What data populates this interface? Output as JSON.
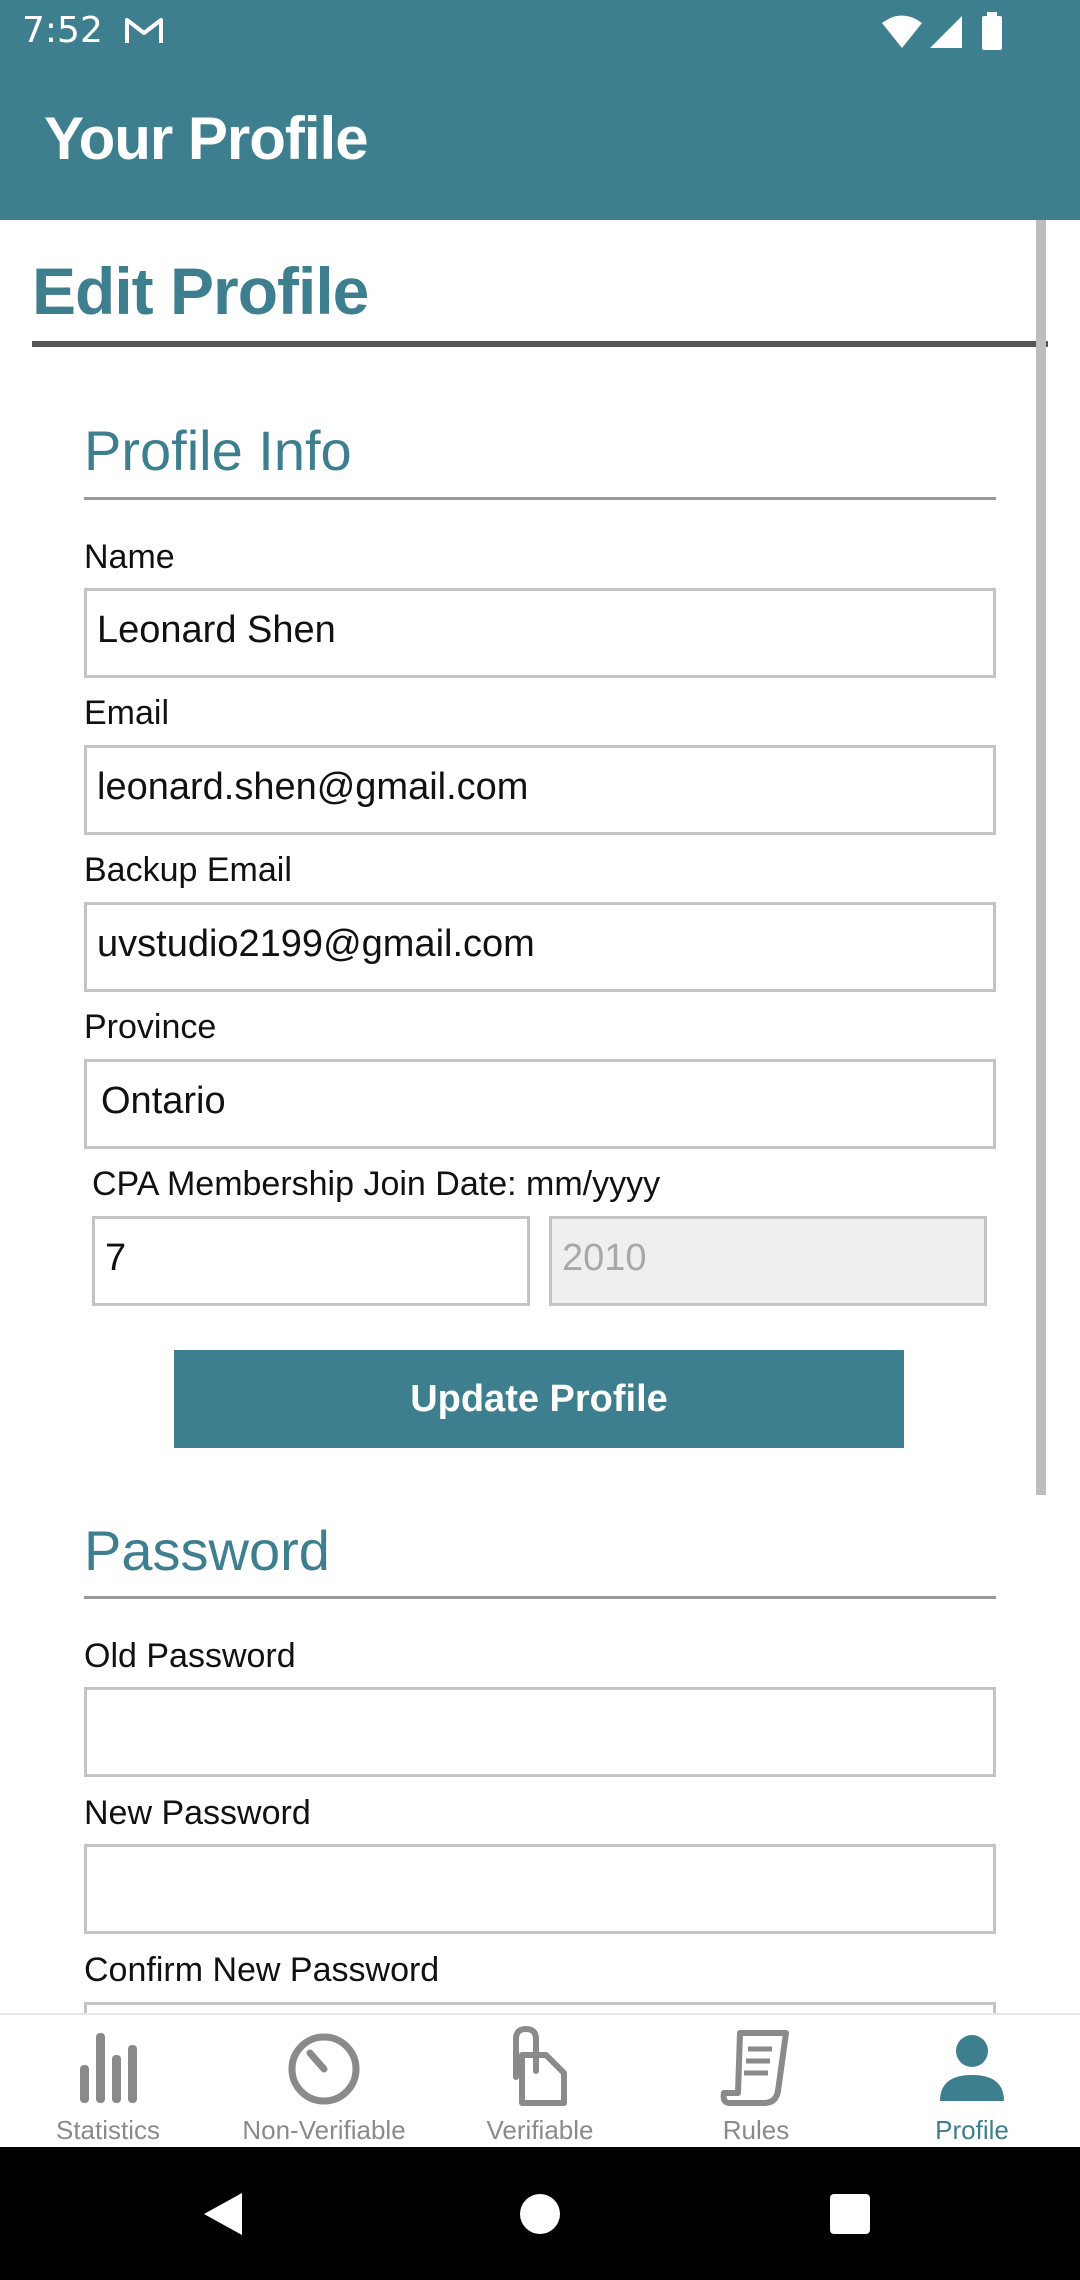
{
  "status_bar": {
    "time": "7:52"
  },
  "app_bar": {
    "title": "Your Profile"
  },
  "page": {
    "title": "Edit Profile"
  },
  "profile_info": {
    "heading": "Profile Info",
    "name_label": "Name",
    "name_value": "Leonard Shen",
    "email_label": "Email",
    "email_value": "leonard.shen@gmail.com",
    "backup_email_label": "Backup Email",
    "backup_email_value": "uvstudio2199@gmail.com",
    "province_label": "Province",
    "province_value": "Ontario",
    "join_date_label": "CPA Membership Join Date: mm/yyyy",
    "join_month_value": "7",
    "join_year_placeholder": "2010",
    "update_button": "Update Profile"
  },
  "password": {
    "heading": "Password",
    "old_label": "Old Password",
    "new_label": "New Password",
    "confirm_label": "Confirm New Password"
  },
  "bottom_nav": {
    "items": [
      {
        "label": "Statistics",
        "icon": "bar-chart-icon",
        "active": false
      },
      {
        "label": "Non-Verifiable",
        "icon": "gauge-icon",
        "active": false
      },
      {
        "label": "Verifiable",
        "icon": "paperclip-document-icon",
        "active": false
      },
      {
        "label": "Rules",
        "icon": "scroll-icon",
        "active": false
      },
      {
        "label": "Profile",
        "icon": "person-icon",
        "active": true
      }
    ]
  },
  "colors": {
    "accent": "#3e7f8f",
    "inactive": "#8a8a8a",
    "background": "#ffffff"
  }
}
